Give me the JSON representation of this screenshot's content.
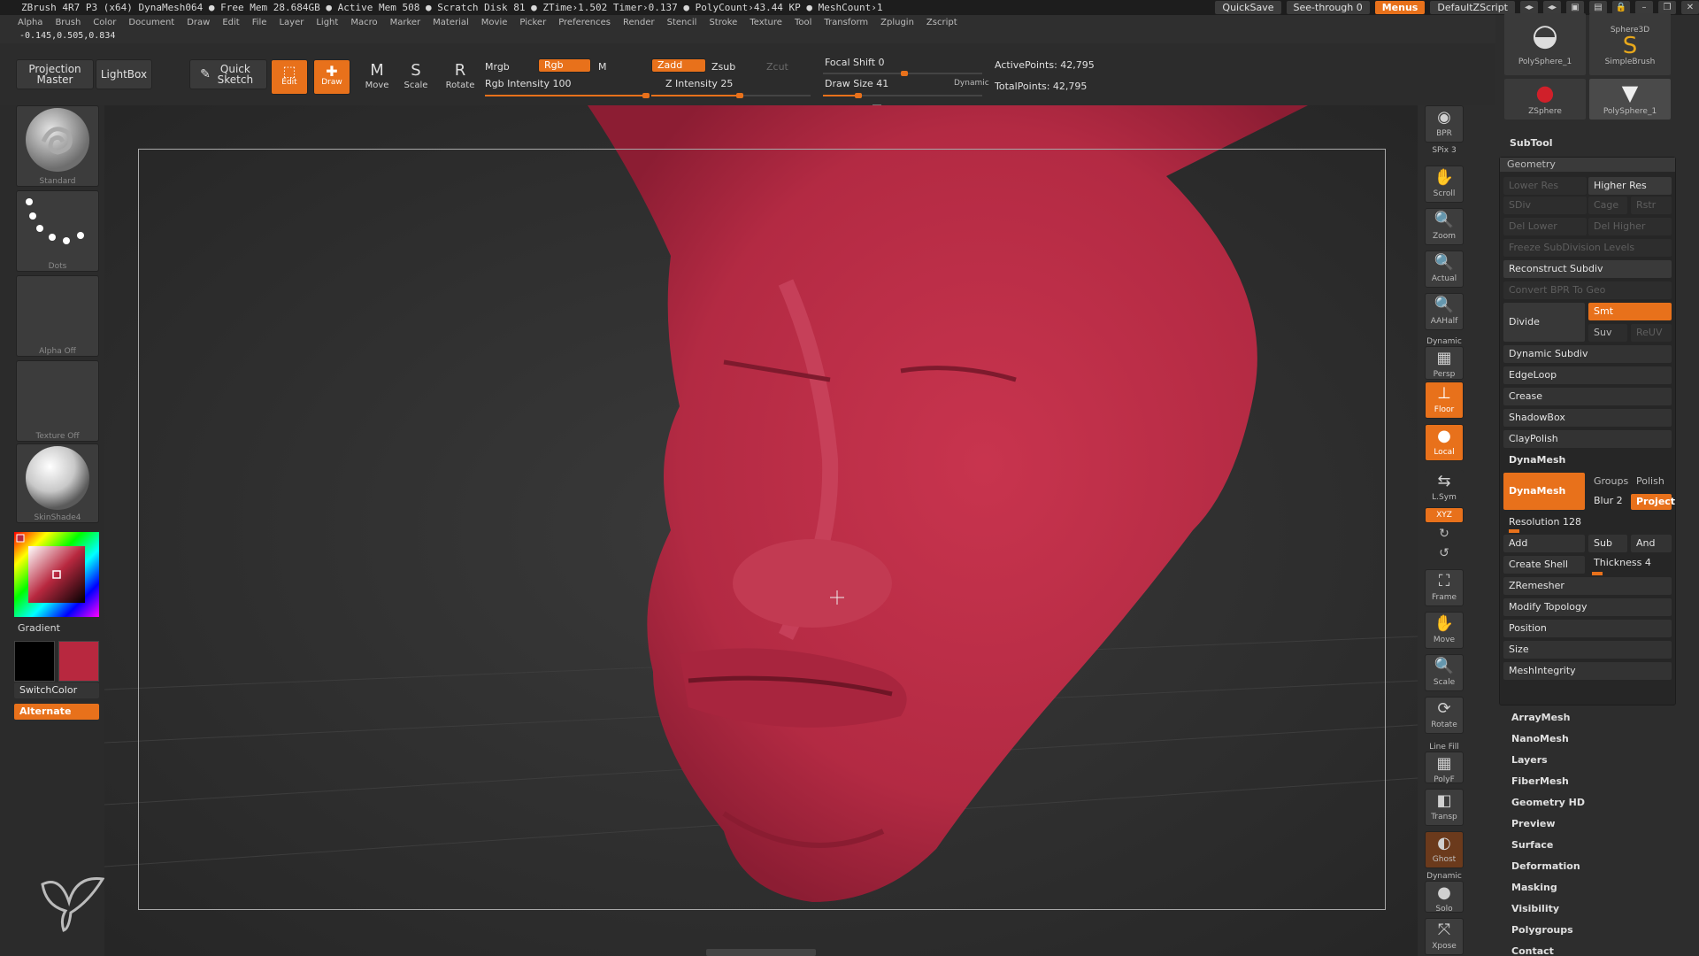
{
  "titlebar": {
    "title": "ZBrush 4R7 P3 (x64)   DynaMesh064   ● Free Mem 28.684GB ● Active Mem 508 ● Scratch Disk 81 ● ZTime›1.502 Timer›0.137 ● PolyCount›43.44 KP ● MeshCount›1",
    "quicksave": "QuickSave",
    "see_through": "See-through  0",
    "menus_btn": "Menus",
    "script": "DefaultZScript"
  },
  "menubar": {
    "items": [
      "Alpha",
      "Brush",
      "Color",
      "Document",
      "Draw",
      "Edit",
      "File",
      "Layer",
      "Light",
      "Macro",
      "Marker",
      "Material",
      "Movie",
      "Picker",
      "Preferences",
      "Render",
      "Stencil",
      "Stroke",
      "Texture",
      "Tool",
      "Transform",
      "Zplugin",
      "Zscript"
    ],
    "coords": "-0.145,0.505,0.834"
  },
  "toolbar": {
    "projection_master": "Projection Master",
    "lightbox": "LightBox",
    "quick_sketch": "Quick Sketch",
    "edit": "Edit",
    "draw": "Draw",
    "move": "Move",
    "scale": "Scale",
    "rotate": "Rotate",
    "mrgb": "Mrgb",
    "rgb": "Rgb",
    "m": "M",
    "rgb_intensity": "Rgb Intensity 100",
    "zadd": "Zadd",
    "zsub": "Zsub",
    "zcut": "Zcut",
    "z_intensity": "Z Intensity 25",
    "focal_shift": "Focal Shift 0",
    "draw_size": "Draw Size 41",
    "dynamic": "Dynamic",
    "active_points": "ActivePoints: 42,795",
    "total_points": "TotalPoints: 42,795"
  },
  "leftpanel": {
    "brush": "Standard",
    "stroke": "Dots",
    "alpha": "Alpha  Off",
    "texture": "Texture  Off",
    "material": "SkinShade4",
    "gradient": "Gradient",
    "switchcolor": "SwitchColor",
    "alternate": "Alternate"
  },
  "rightcol": {
    "bpr": "BPR",
    "spix": "SPix 3",
    "scroll": "Scroll",
    "zoom": "Zoom",
    "actual": "Actual",
    "aahalf": "AAHalf",
    "dynamic": "Dynamic",
    "persp": "Persp",
    "floor": "Floor",
    "local": "Local",
    "lsym": "L.Sym",
    "xyz": "XYZ",
    "frame": "Frame",
    "move": "Move",
    "scale": "Scale",
    "rotate": "Rotate",
    "linefill": "Line Fill",
    "polyf": "PolyF",
    "transp": "Transp",
    "ghost": "Ghost",
    "dynamic2": "Dynamic",
    "solo": "Solo",
    "xpose": "Xpose"
  },
  "palette": {
    "tiles": [
      "PolySphere_1",
      "SimpleBrush",
      "ZSphere",
      "PolySphere_1"
    ],
    "tile_top": "Sphere3D",
    "subtool": "SubTool",
    "geometry": "Geometry",
    "lower_res": "Lower Res",
    "higher_res": "Higher Res",
    "sdiv": "SDiv",
    "cage": "Cage",
    "rstr": "Rstr",
    "del_lower": "Del Lower",
    "del_higher": "Del Higher",
    "freeze": "Freeze SubDivision Levels",
    "reconstruct": "Reconstruct Subdiv",
    "convert_bpr": "Convert BPR To Geo",
    "divide": "Divide",
    "smt": "Smt",
    "suv": "Suv",
    "reuv": "ReUV",
    "dynamic_subdiv": "Dynamic Subdiv",
    "edgeloop": "EdgeLoop",
    "crease": "Crease",
    "shadowbox": "ShadowBox",
    "claypolish": "ClayPolish",
    "dynamesh_head": "DynaMesh",
    "dynamesh_btn": "DynaMesh",
    "groups": "Groups",
    "polish": "Polish",
    "blur": "Blur 2",
    "project": "Project",
    "resolution": "Resolution 128",
    "add": "Add",
    "sub": "Sub",
    "and": "And",
    "create_shell": "Create Shell",
    "thickness": "Thickness 4",
    "zremesher": "ZRemesher",
    "modify_topology": "Modify Topology",
    "position": "Position",
    "size": "Size",
    "meshintegrity": "MeshIntegrity",
    "sections": [
      "ArrayMesh",
      "NanoMesh",
      "Layers",
      "FiberMesh",
      "Geometry HD",
      "Preview",
      "Surface",
      "Deformation",
      "Masking",
      "Visibility",
      "Polygroups",
      "Contact"
    ]
  },
  "colors": {
    "accent": "#e8711b",
    "mesh": "#b82a44",
    "primary_color": "#b8283f",
    "secondary_color": "#000000"
  }
}
